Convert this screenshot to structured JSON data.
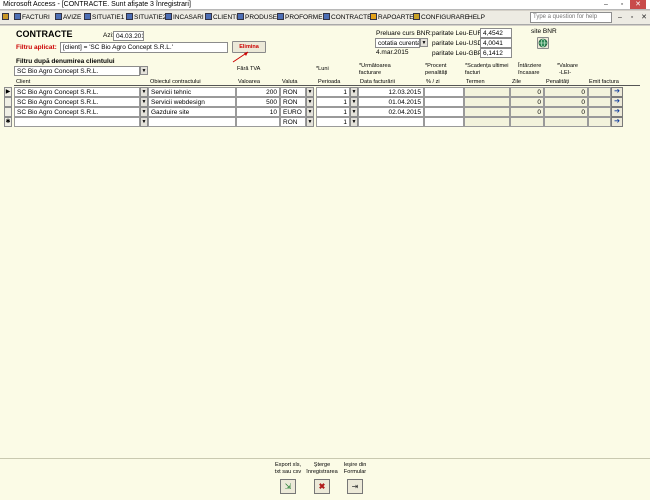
{
  "window": {
    "title": "Microsoft Access - [CONTRACTE. Sunt afişate 3 înregistrari]"
  },
  "menu": {
    "items": [
      "FACTURI",
      "AVIZE",
      "SITUATIE1",
      "SITUATIE2",
      "INCASARI",
      "CLIENTI",
      "PRODUSE",
      "PROFORME",
      "CONTRACTE",
      "RAPOARTE",
      "CONFIGURARE",
      "HELP"
    ],
    "help_placeholder": "Type a question for help"
  },
  "form": {
    "title": "CONTRACTE",
    "today_label": "Azi:",
    "today_value": "04.03.2015",
    "filter_applied_label": "Filtru aplicat:",
    "filter_applied_value": "[client] = 'SC Bio Agro Concept S.R.L.'",
    "remove_button": "Elimina",
    "filter_client_label": "Filtru după denumirea clientului",
    "filter_client_value": "SC Bio Agro Concept S.R.L.",
    "bnr": {
      "label": "Preluare curs BNR:",
      "select_value": "cotatia curenta",
      "date": "4.mar.2015",
      "eur_label": "paritate Leu-EUR:",
      "eur_value": "4,4542",
      "usd_label": "paritate Leu-USD:",
      "usd_value": "4,0041",
      "gbp_label": "paritate Leu-GBP:",
      "gbp_value": "6,1412",
      "site_label": "site BNR"
    }
  },
  "table": {
    "columns": {
      "client": "Client",
      "obiect": "Obiectul contractului",
      "valoarea_top": "Fără TVA",
      "valoarea": "Valoarea",
      "valuta": "Valuta",
      "luni": "*Luni",
      "perioada": "Perioada",
      "urmatoarea_top": "*Următoarea",
      "urmatoarea_mid": "facturare",
      "data_facturarii": "Data facturării",
      "procent_top": "*Procent",
      "procent_mid": "penalități",
      "procent": "% / zi",
      "scadenta_top": "*Scadența ultimei",
      "scadenta_mid": "facturi",
      "termen": "Termen",
      "intarziere_top": "Întârziere",
      "intarziere_mid": "încasare",
      "zile": "Zile",
      "penalitati": "Penalități",
      "valoare_top": "*Valoare",
      "valoare_mid": "-LEI-",
      "emit": "Emit factura"
    },
    "rows": [
      {
        "client": "SC Bio Agro Concept S.R.L.",
        "obiect": "Servicii tehnic",
        "valoarea": "200",
        "valuta": "RON",
        "perioada": "1",
        "data": "12.03.2015",
        "zile": "0",
        "penalitati": "0"
      },
      {
        "client": "SC Bio Agro Concept S.R.L.",
        "obiect": "Servicii webdesign",
        "valoarea": "500",
        "valuta": "RON",
        "perioada": "1",
        "data": "01.04.2015",
        "zile": "0",
        "penalitati": "0"
      },
      {
        "client": "SC Bio Agro Concept S.R.L.",
        "obiect": "Gazduire site",
        "valoarea": "10",
        "valuta": "EURO",
        "perioada": "1",
        "data": "02.04.2015",
        "zile": "0",
        "penalitati": "0"
      }
    ],
    "new_row": {
      "valuta": "RON",
      "perioada": "1"
    },
    "current_marker": "▶",
    "new_marker": "✱"
  },
  "footer": {
    "export_line1": "Export xls,",
    "export_line2": "txt sau csv",
    "delete_line1": "Şterge",
    "delete_line2": "înregistrarea",
    "exit_line1": "Ieşire din",
    "exit_line2": "Formular"
  },
  "colors": {
    "form_background": "#fbfbe6",
    "filter_label": "#cc0000",
    "nav_arrow": "#123f9e"
  }
}
